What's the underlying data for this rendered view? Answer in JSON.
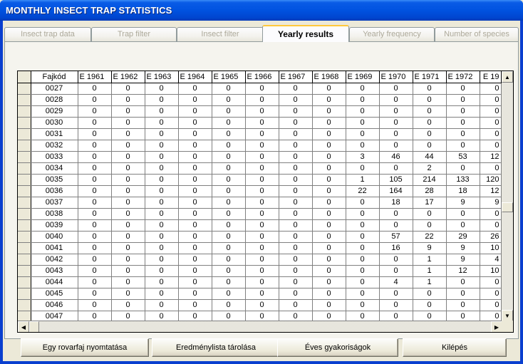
{
  "window": {
    "title": "MONTHLY INSECT TRAP STATISTICS"
  },
  "tabs": [
    {
      "label": "Insect trap data",
      "active": false
    },
    {
      "label": "Trap filter",
      "active": false
    },
    {
      "label": "Insect filter",
      "active": false
    },
    {
      "label": "Yearly results",
      "active": true
    },
    {
      "label": "Yearly frequency",
      "active": false
    },
    {
      "label": "Number of species",
      "active": false
    }
  ],
  "grid": {
    "columns": [
      "Fajkód",
      "E  1961",
      "E  1962",
      "E  1963",
      "E  1964",
      "E  1965",
      "E  1966",
      "E  1967",
      "E  1968",
      "E  1969",
      "E  1970",
      "E  1971",
      "E  1972",
      "E  19"
    ],
    "rows": [
      [
        "0027",
        "0",
        "0",
        "0",
        "0",
        "0",
        "0",
        "0",
        "0",
        "0",
        "0",
        "0",
        "0",
        "0"
      ],
      [
        "0028",
        "0",
        "0",
        "0",
        "0",
        "0",
        "0",
        "0",
        "0",
        "0",
        "0",
        "0",
        "0",
        "0"
      ],
      [
        "0029",
        "0",
        "0",
        "0",
        "0",
        "0",
        "0",
        "0",
        "0",
        "0",
        "0",
        "0",
        "0",
        "0"
      ],
      [
        "0030",
        "0",
        "0",
        "0",
        "0",
        "0",
        "0",
        "0",
        "0",
        "0",
        "0",
        "0",
        "0",
        "0"
      ],
      [
        "0031",
        "0",
        "0",
        "0",
        "0",
        "0",
        "0",
        "0",
        "0",
        "0",
        "0",
        "0",
        "0",
        "0"
      ],
      [
        "0032",
        "0",
        "0",
        "0",
        "0",
        "0",
        "0",
        "0",
        "0",
        "0",
        "0",
        "0",
        "0",
        "0"
      ],
      [
        "0033",
        "0",
        "0",
        "0",
        "0",
        "0",
        "0",
        "0",
        "0",
        "3",
        "46",
        "44",
        "53",
        "12"
      ],
      [
        "0034",
        "0",
        "0",
        "0",
        "0",
        "0",
        "0",
        "0",
        "0",
        "0",
        "0",
        "2",
        "0",
        "0"
      ],
      [
        "0035",
        "0",
        "0",
        "0",
        "0",
        "0",
        "0",
        "0",
        "0",
        "1",
        "105",
        "214",
        "133",
        "120"
      ],
      [
        "0036",
        "0",
        "0",
        "0",
        "0",
        "0",
        "0",
        "0",
        "0",
        "22",
        "164",
        "28",
        "18",
        "12"
      ],
      [
        "0037",
        "0",
        "0",
        "0",
        "0",
        "0",
        "0",
        "0",
        "0",
        "0",
        "18",
        "17",
        "9",
        "9"
      ],
      [
        "0038",
        "0",
        "0",
        "0",
        "0",
        "0",
        "0",
        "0",
        "0",
        "0",
        "0",
        "0",
        "0",
        "0"
      ],
      [
        "0039",
        "0",
        "0",
        "0",
        "0",
        "0",
        "0",
        "0",
        "0",
        "0",
        "0",
        "0",
        "0",
        "0"
      ],
      [
        "0040",
        "0",
        "0",
        "0",
        "0",
        "0",
        "0",
        "0",
        "0",
        "0",
        "57",
        "22",
        "29",
        "26"
      ],
      [
        "0041",
        "0",
        "0",
        "0",
        "0",
        "0",
        "0",
        "0",
        "0",
        "0",
        "16",
        "9",
        "9",
        "10"
      ],
      [
        "0042",
        "0",
        "0",
        "0",
        "0",
        "0",
        "0",
        "0",
        "0",
        "0",
        "0",
        "1",
        "9",
        "4"
      ],
      [
        "0043",
        "0",
        "0",
        "0",
        "0",
        "0",
        "0",
        "0",
        "0",
        "0",
        "0",
        "1",
        "12",
        "10"
      ],
      [
        "0044",
        "0",
        "0",
        "0",
        "0",
        "0",
        "0",
        "0",
        "0",
        "0",
        "4",
        "1",
        "0",
        "0"
      ],
      [
        "0045",
        "0",
        "0",
        "0",
        "0",
        "0",
        "0",
        "0",
        "0",
        "0",
        "0",
        "0",
        "0",
        "0"
      ],
      [
        "0046",
        "0",
        "0",
        "0",
        "0",
        "0",
        "0",
        "0",
        "0",
        "0",
        "0",
        "0",
        "0",
        "0"
      ],
      [
        "0047",
        "0",
        "0",
        "0",
        "0",
        "0",
        "0",
        "0",
        "0",
        "0",
        "0",
        "0",
        "0",
        "0"
      ]
    ],
    "scroll": {
      "vertical_position": 0.55,
      "horizontal_position": 0.0
    }
  },
  "buttons": {
    "print_species": "Egy rovarfaj  nyomtatása",
    "save_results": "Eredménylista tárolása",
    "yearly_frequencies": "Éves gyakoriságok",
    "exit": "Kilépés"
  },
  "icons": {
    "scroll_up": "▲",
    "scroll_down": "▼",
    "scroll_left": "◀",
    "scroll_right": "▶"
  }
}
